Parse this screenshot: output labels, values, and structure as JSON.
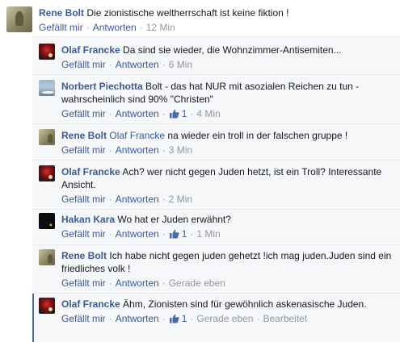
{
  "top": {
    "author": "Rene Bolt",
    "text": "Die zionistische weltherrschaft ist keine fiktion !",
    "like_label": "Gefällt mir",
    "reply_label": "Antworten",
    "time": "12 Min"
  },
  "replies": [
    {
      "author": "Olaf Francke",
      "mention": "",
      "text": "Da sind sie wieder, die Wohnzimmer-Antisemiten...",
      "like_label": "Gefällt mir",
      "reply_label": "Antworten",
      "likes": "",
      "time": "6 Min",
      "edited": ""
    },
    {
      "author": "Norbert Piechotta",
      "mention": "",
      "text": "Bolt - das hat NUR mit asozialen Reichen zu tun - wahrscheinlich sind 90% \"Christen\"",
      "like_label": "Gefällt mir",
      "reply_label": "Antworten",
      "likes": "1",
      "time": "4 Min",
      "edited": ""
    },
    {
      "author": "Rene Bolt",
      "mention": "Olaf Francke",
      "text": "na wieder ein troll in der falschen gruppe !",
      "like_label": "Gefällt mir",
      "reply_label": "Antworten",
      "likes": "",
      "time": "3 Min",
      "edited": ""
    },
    {
      "author": "Olaf Francke",
      "mention": "",
      "text": "Ach? wer nicht gegen Juden hetzt, ist ein Troll? Interessante Ansicht.",
      "like_label": "Gefällt mir",
      "reply_label": "Antworten",
      "likes": "",
      "time": "2 Min",
      "edited": ""
    },
    {
      "author": "Hakan Kara",
      "mention": "",
      "text": "Wo hat er Juden erwähnt?",
      "like_label": "Gefällt mir",
      "reply_label": "Antworten",
      "likes": "1",
      "time": "1 Min",
      "edited": ""
    },
    {
      "author": "Rene Bolt",
      "mention": "",
      "text": "Ich habe nicht gegen juden gehetzt !ich mag juden.Juden sind ein friedliches volk !",
      "like_label": "Gefällt mir",
      "reply_label": "Antworten",
      "likes": "",
      "time": "Gerade eben",
      "edited": ""
    },
    {
      "author": "Olaf Francke",
      "mention": "",
      "text": "Ähm, Zionisten sind für gewöhnlich askenasische Juden.",
      "like_label": "Gefällt mir",
      "reply_label": "Antworten",
      "likes": "1",
      "time": "Gerade eben",
      "edited": "Bearbeitet"
    }
  ]
}
